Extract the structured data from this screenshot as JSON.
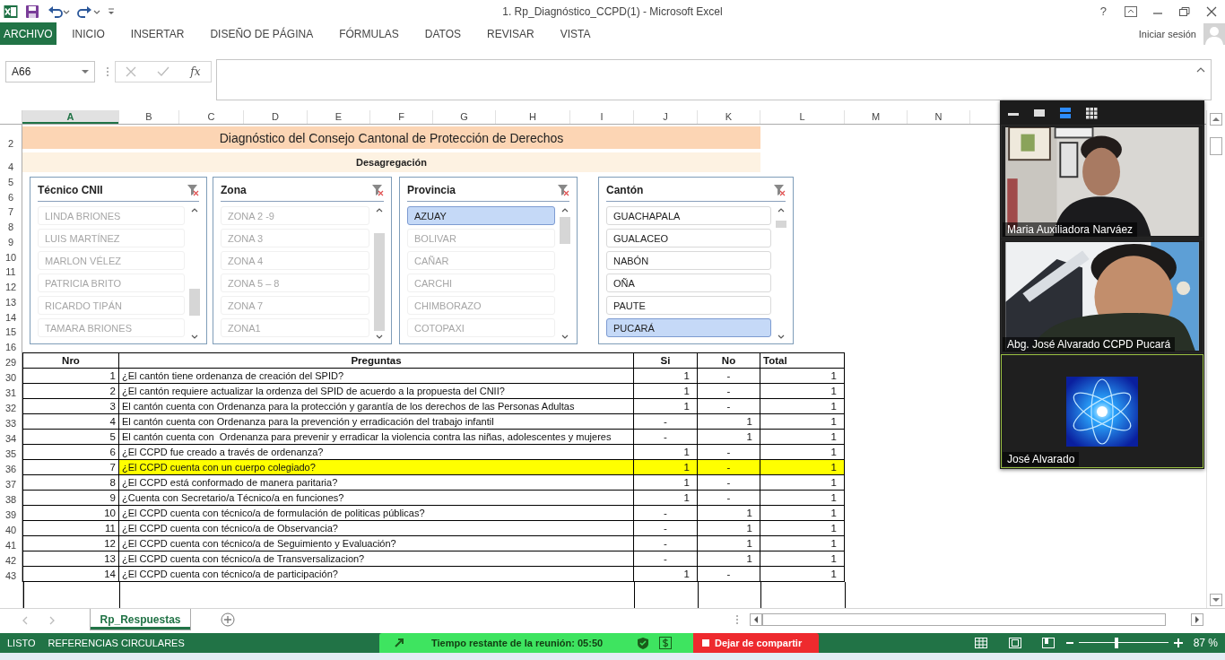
{
  "window": {
    "title": "1. Rp_Diagnóstico_CCPD(1) - Microsoft Excel",
    "help": "?"
  },
  "ribbon": {
    "tabs": [
      {
        "label": "ARCHIVO",
        "kind": "file",
        "selected": false
      },
      {
        "label": "INICIO",
        "kind": "tab",
        "selected": false
      },
      {
        "label": "INSERTAR",
        "kind": "tab",
        "selected": false
      },
      {
        "label": "DISEÑO DE PÁGINA",
        "kind": "tab",
        "selected": false
      },
      {
        "label": "FÓRMULAS",
        "kind": "tab",
        "selected": false
      },
      {
        "label": "DATOS",
        "kind": "tab",
        "selected": false
      },
      {
        "label": "REVISAR",
        "kind": "tab",
        "selected": false
      },
      {
        "label": "VISTA",
        "kind": "tab",
        "selected": false
      }
    ],
    "account": "Iniciar sesión"
  },
  "formula_bar": {
    "name_box": "A66",
    "function_label": "fx"
  },
  "column_headers": [
    {
      "label": "A",
      "selected": true
    },
    {
      "label": "B",
      "selected": false
    },
    {
      "label": "C",
      "selected": false
    },
    {
      "label": "D",
      "selected": false
    },
    {
      "label": "E",
      "selected": false
    },
    {
      "label": "F",
      "selected": false
    },
    {
      "label": "G",
      "selected": false
    },
    {
      "label": "H",
      "selected": false
    },
    {
      "label": "I",
      "selected": false
    },
    {
      "label": "J",
      "selected": false
    },
    {
      "label": "K",
      "selected": false
    },
    {
      "label": "L",
      "selected": false
    },
    {
      "label": "M",
      "selected": false
    },
    {
      "label": "N",
      "selected": false
    }
  ],
  "sheet": {
    "top_rows": [
      "2",
      "4",
      "5",
      "6",
      "7",
      "8",
      "9",
      "10",
      "11",
      "12",
      "13",
      "14",
      "15",
      "16"
    ],
    "title": "Diagnóstico del Consejo Cantonal de Protección de Derechos",
    "subtitle": "Desagregación",
    "slicers": [
      {
        "title": "Técnico CNII",
        "items": [
          {
            "label": "LINDA BRIONES",
            "selected": false,
            "disabled": true
          },
          {
            "label": "LUIS MARTÍNEZ",
            "selected": false,
            "disabled": true
          },
          {
            "label": "MARLON VÉLEZ",
            "selected": false,
            "disabled": true
          },
          {
            "label": "PATRICIA BRITO",
            "selected": false,
            "disabled": true
          },
          {
            "label": "RICARDO TIPÁN",
            "selected": false,
            "disabled": true
          },
          {
            "label": "TAMARA BRIONES",
            "selected": false,
            "disabled": true
          }
        ]
      },
      {
        "title": "Zona",
        "items": [
          {
            "label": "ZONA 2 -9",
            "selected": false,
            "disabled": true
          },
          {
            "label": "ZONA 3",
            "selected": false,
            "disabled": true
          },
          {
            "label": "ZONA 4",
            "selected": false,
            "disabled": true
          },
          {
            "label": "ZONA 5 – 8",
            "selected": false,
            "disabled": true
          },
          {
            "label": "ZONA 7",
            "selected": false,
            "disabled": true
          },
          {
            "label": "ZONA1",
            "selected": false,
            "disabled": true
          }
        ]
      },
      {
        "title": "Provincia",
        "items": [
          {
            "label": "AZUAY",
            "selected": true,
            "disabled": false
          },
          {
            "label": "BOLIVAR",
            "selected": false,
            "disabled": true
          },
          {
            "label": "CAÑAR",
            "selected": false,
            "disabled": true
          },
          {
            "label": "CARCHI",
            "selected": false,
            "disabled": true
          },
          {
            "label": "CHIMBORAZO",
            "selected": false,
            "disabled": true
          },
          {
            "label": "COTOPAXI",
            "selected": false,
            "disabled": true
          }
        ]
      },
      {
        "title": "Cantón",
        "items": [
          {
            "label": "GUACHAPALA",
            "selected": false,
            "disabled": false
          },
          {
            "label": "GUALACEO",
            "selected": false,
            "disabled": false
          },
          {
            "label": "NABÓN",
            "selected": false,
            "disabled": false
          },
          {
            "label": "OÑA",
            "selected": false,
            "disabled": false
          },
          {
            "label": "PAUTE",
            "selected": false,
            "disabled": false
          },
          {
            "label": "PUCARÁ",
            "selected": true,
            "disabled": false
          }
        ]
      }
    ],
    "table": {
      "header_row": "29",
      "columns": [
        "Nro",
        "Preguntas",
        "Si",
        "No",
        "Total"
      ],
      "rows": [
        {
          "row": "30",
          "highlighted": false,
          "cells": [
            "1",
            "¿El cantón tiene ordenanza de creación del SPID?",
            "1",
            "-",
            "1"
          ]
        },
        {
          "row": "31",
          "highlighted": false,
          "cells": [
            "2",
            "¿El cantón requiere actualizar la ordenza del SPID de acuerdo a la propuesta del CNII?",
            "1",
            "-",
            "1"
          ]
        },
        {
          "row": "32",
          "highlighted": false,
          "cells": [
            "3",
            "El cantón cuenta con Ordenanza para la protección y garantía de los derechos de las Personas Adultas",
            "1",
            "-",
            "1"
          ]
        },
        {
          "row": "33",
          "highlighted": false,
          "cells": [
            "4",
            "El cantón cuenta con Ordenanza para la prevención y erradicación del trabajo infantil",
            "-",
            "1",
            "1"
          ]
        },
        {
          "row": "34",
          "highlighted": false,
          "cells": [
            "5",
            "El cantón cuenta con  Ordenanza para prevenir y erradicar la violencia contra las niñas, adolescentes y mujeres",
            "-",
            "1",
            "1"
          ]
        },
        {
          "row": "35",
          "highlighted": false,
          "cells": [
            "6",
            "¿El CCPD fue creado a través de ordenanza?",
            "1",
            "-",
            "1"
          ]
        },
        {
          "row": "36",
          "highlighted": true,
          "cells": [
            "7",
            "¿El CCPD cuenta con un cuerpo colegiado?",
            "1",
            "-",
            "1"
          ]
        },
        {
          "row": "37",
          "highlighted": false,
          "cells": [
            "8",
            "¿El CCPD está conformado de manera paritaria?",
            "1",
            "-",
            "1"
          ]
        },
        {
          "row": "38",
          "highlighted": false,
          "cells": [
            "9",
            "¿Cuenta con Secretario/a Técnico/a en funciones?",
            "1",
            "-",
            "1"
          ]
        },
        {
          "row": "39",
          "highlighted": false,
          "cells": [
            "10",
            "¿El CCPD cuenta con técnico/a de formulación de politicas públicas?",
            "-",
            "1",
            "1"
          ]
        },
        {
          "row": "40",
          "highlighted": false,
          "cells": [
            "11",
            "¿El CCPD cuenta con técnico/a de Observancia?",
            "-",
            "1",
            "1"
          ]
        },
        {
          "row": "41",
          "highlighted": false,
          "cells": [
            "12",
            "¿El CCPD cuenta con técnico/a de Seguimiento y Evaluación?",
            "-",
            "1",
            "1"
          ]
        },
        {
          "row": "42",
          "highlighted": false,
          "cells": [
            "13",
            "¿El CCPD cuenta con técnico/a de Transversalizacion?",
            "-",
            "1",
            "1"
          ]
        },
        {
          "row": "43",
          "highlighted": false,
          "cells": [
            "14",
            "¿El CCPD cuenta con técnico/a de participación?",
            "1",
            "-",
            "1"
          ]
        }
      ]
    }
  },
  "sheet_tabs": [
    {
      "label": "Rp_Respuestas",
      "selected": true
    }
  ],
  "status_bar": {
    "ready": "LISTO",
    "circular_references": "REFERENCIAS CIRCULARES",
    "zoom": "87 %",
    "zoom_slider": {
      "level": 0.42
    }
  },
  "meeting": {
    "time_left": "Tiempo restante de la reunión: 05:50",
    "stop_share": "Dejar de compartir"
  },
  "video_panel": {
    "view_modes": [
      {
        "kind": "minimize",
        "selected": false
      },
      {
        "kind": "speaker",
        "selected": false
      },
      {
        "kind": "strip",
        "selected": true
      },
      {
        "kind": "gallery",
        "selected": false
      }
    ],
    "participants": [
      {
        "name": "Maria Auxiliadora Narváez",
        "kind": "video",
        "active_speaker": false
      },
      {
        "name": "Abg. José Alvarado CCPD Pucará",
        "kind": "video",
        "active_speaker": false
      },
      {
        "name": "José Alvarado",
        "kind": "avatar",
        "active_speaker": true
      }
    ]
  }
}
